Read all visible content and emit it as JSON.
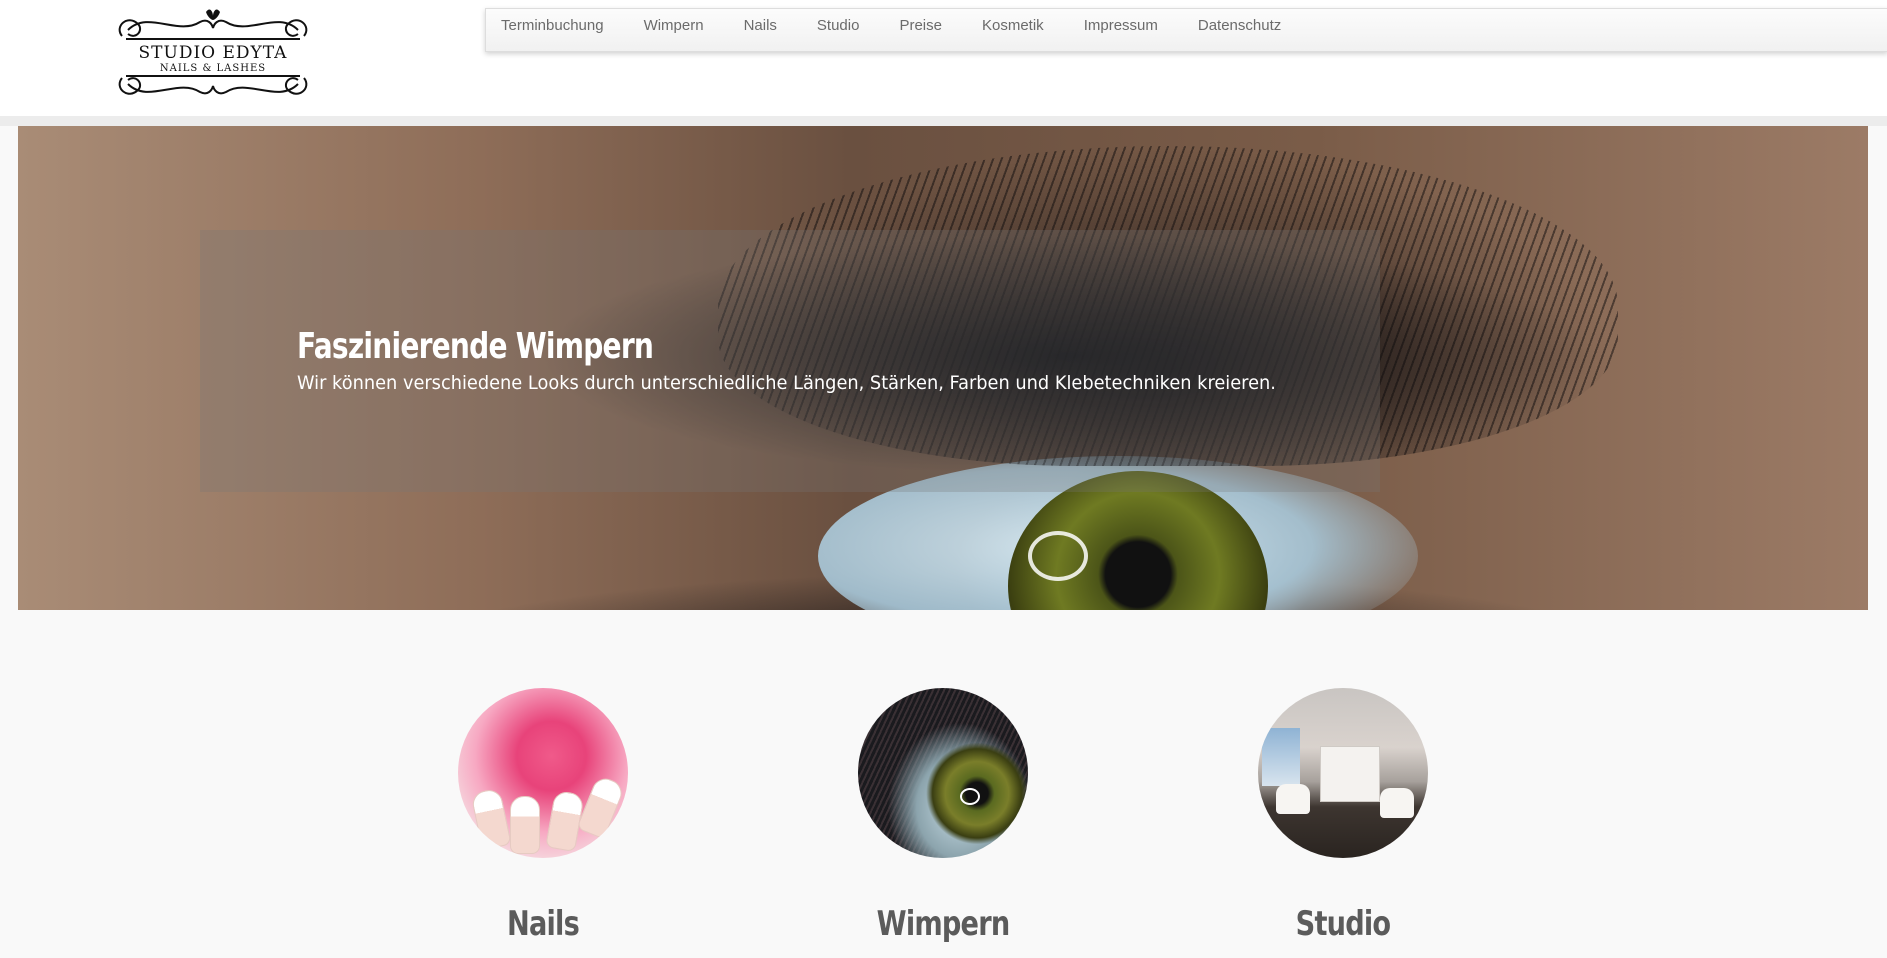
{
  "header": {
    "logo": {
      "title": "STUDIO EDYTA",
      "subtitle": "NAILS & LASHES"
    },
    "nav": [
      {
        "label": "Terminbuchung"
      },
      {
        "label": "Wimpern"
      },
      {
        "label": "Nails"
      },
      {
        "label": "Studio"
      },
      {
        "label": "Preise"
      },
      {
        "label": "Kosmetik"
      },
      {
        "label": "Impressum"
      },
      {
        "label": "Datenschutz"
      }
    ]
  },
  "hero": {
    "title": "Faszinierende Wimpern",
    "text": "Wir können verschiedene Looks durch unterschiedliche Längen, Stärken, Farben und Klebetechniken kreieren."
  },
  "features": [
    {
      "title": "Nails",
      "image": "nails-rose-photo"
    },
    {
      "title": "Wimpern",
      "image": "eye-lashes-photo"
    },
    {
      "title": "Studio",
      "image": "studio-interior-photo"
    }
  ],
  "colors": {
    "nav_text": "#6b6b6b",
    "feature_title": "#5b5b5b",
    "page_bg": "#f9f9f9",
    "header_bg": "#ffffff"
  }
}
